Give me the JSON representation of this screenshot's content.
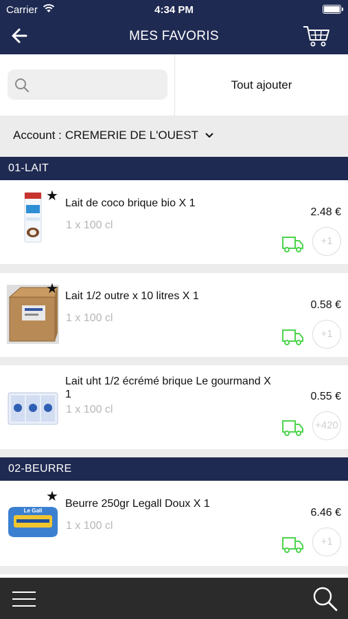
{
  "status_bar": {
    "carrier": "Carrier",
    "time": "4:34 PM"
  },
  "header": {
    "title": "MES FAVORIS"
  },
  "toolbar": {
    "search_placeholder": "",
    "add_all_label": "Tout ajouter"
  },
  "account": {
    "label": "Account :",
    "value": "CREMERIE DE L'OUEST"
  },
  "sections": [
    {
      "title": "01-LAIT"
    },
    {
      "title": "02-BEURRE"
    }
  ],
  "products": [
    {
      "name": "Lait  de coco brique bio X 1",
      "unit": "1 x 100 cl",
      "price": "2.48 €",
      "plus": "+1",
      "favorite": true
    },
    {
      "name": "Lait 1/2 outre x 10 litres X 1",
      "unit": "1 x 100 cl",
      "price": "0.58 €",
      "plus": "+1",
      "favorite": true
    },
    {
      "name": "Lait uht 1/2 écrémé brique Le gourmand X 1",
      "unit": "1 x 100 cl",
      "price": "0.55 €",
      "plus": "+420",
      "favorite": false
    },
    {
      "name": "Beurre  250gr Legall Doux X 1",
      "unit": "1 x 100 cl",
      "price": "6.46 €",
      "plus": "+1",
      "favorite": true
    }
  ],
  "image_labels": {
    "beurre_brand": "Le Gall"
  },
  "colors": {
    "header": "#1f2a52",
    "tabbar": "#2b2b2b",
    "truck_green": "#4cd44c"
  },
  "icons": {
    "back": "arrow-left-icon",
    "cart": "cart-icon",
    "search": "search-icon",
    "star": "star-icon",
    "truck": "delivery-truck-icon",
    "menu": "hamburger-menu-icon"
  }
}
